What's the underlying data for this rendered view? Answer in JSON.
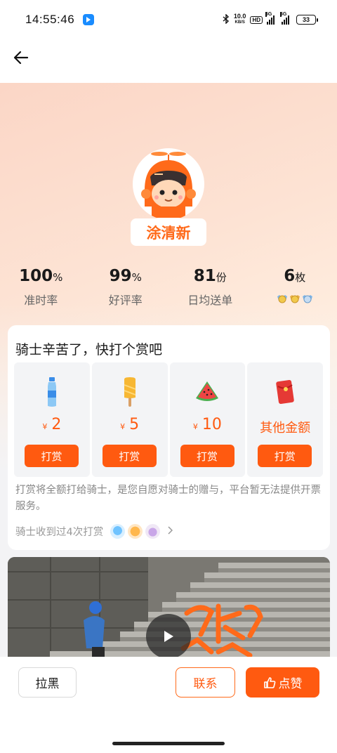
{
  "status_bar": {
    "time": "14:55:46",
    "net_speed_value": "10.0",
    "net_speed_unit": "KB/S",
    "hd_label": "HD",
    "signal1_label": "5G",
    "signal2_label": "5G",
    "battery": "33",
    "icons": [
      "app-notification-icon",
      "bluetooth-icon",
      "hd-icon",
      "signal-icon",
      "signal-icon",
      "battery-icon"
    ]
  },
  "nav": {
    "back_icon": "arrow-left-icon"
  },
  "rider": {
    "name": "涂清新",
    "avatar_icon": "rider-helmet-avatar"
  },
  "stats": [
    {
      "value": "100",
      "unit": "%",
      "label": "准时率"
    },
    {
      "value": "99",
      "unit": "%",
      "label": "好评率"
    },
    {
      "value": "81",
      "unit": "份",
      "label": "日均送单"
    },
    {
      "value": "6",
      "unit": "枚",
      "label": "",
      "medals": [
        "medal-icon",
        "medal-icon",
        "medal-icon"
      ]
    }
  ],
  "tip": {
    "title": "骑士辛苦了，快打个赏吧",
    "currency": "¥",
    "options": [
      {
        "icon": "water-bottle-icon",
        "amount": "2",
        "button": "打赏"
      },
      {
        "icon": "popsicle-icon",
        "amount": "5",
        "button": "打赏"
      },
      {
        "icon": "watermelon-icon",
        "amount": "10",
        "button": "打赏"
      },
      {
        "icon": "red-envelope-icon",
        "amount": "其他金额",
        "button": "打赏"
      }
    ],
    "note": "打赏将全额打给骑士，是您自愿对骑士的赠与，平台暂无法提供开票服务。",
    "history": "骑士收到过4次打赏"
  },
  "video": {
    "play_icon": "play-icon",
    "thumbnail": "rider-on-stairs"
  },
  "actions": {
    "block_label": "拉黑",
    "contact_label": "联系",
    "like_label": "点赞",
    "like_icon": "thumbs-up-icon"
  },
  "colors": {
    "accent": "#ff5a10",
    "name": "#ff6a1a"
  }
}
